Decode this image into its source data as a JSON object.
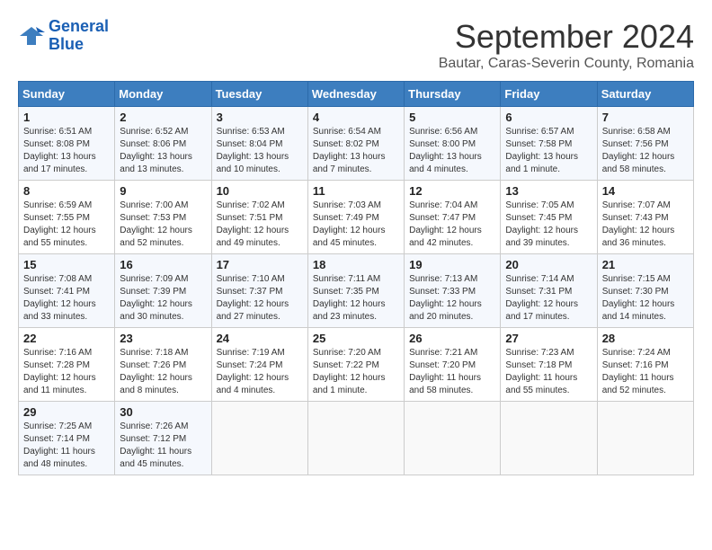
{
  "logo": {
    "line1": "General",
    "line2": "Blue"
  },
  "title": "September 2024",
  "subtitle": "Bautar, Caras-Severin County, Romania",
  "days_header": [
    "Sunday",
    "Monday",
    "Tuesday",
    "Wednesday",
    "Thursday",
    "Friday",
    "Saturday"
  ],
  "weeks": [
    [
      {
        "day": "1",
        "info": "Sunrise: 6:51 AM\nSunset: 8:08 PM\nDaylight: 13 hours\nand 17 minutes."
      },
      {
        "day": "2",
        "info": "Sunrise: 6:52 AM\nSunset: 8:06 PM\nDaylight: 13 hours\nand 13 minutes."
      },
      {
        "day": "3",
        "info": "Sunrise: 6:53 AM\nSunset: 8:04 PM\nDaylight: 13 hours\nand 10 minutes."
      },
      {
        "day": "4",
        "info": "Sunrise: 6:54 AM\nSunset: 8:02 PM\nDaylight: 13 hours\nand 7 minutes."
      },
      {
        "day": "5",
        "info": "Sunrise: 6:56 AM\nSunset: 8:00 PM\nDaylight: 13 hours\nand 4 minutes."
      },
      {
        "day": "6",
        "info": "Sunrise: 6:57 AM\nSunset: 7:58 PM\nDaylight: 13 hours\nand 1 minute."
      },
      {
        "day": "7",
        "info": "Sunrise: 6:58 AM\nSunset: 7:56 PM\nDaylight: 12 hours\nand 58 minutes."
      }
    ],
    [
      {
        "day": "8",
        "info": "Sunrise: 6:59 AM\nSunset: 7:55 PM\nDaylight: 12 hours\nand 55 minutes."
      },
      {
        "day": "9",
        "info": "Sunrise: 7:00 AM\nSunset: 7:53 PM\nDaylight: 12 hours\nand 52 minutes."
      },
      {
        "day": "10",
        "info": "Sunrise: 7:02 AM\nSunset: 7:51 PM\nDaylight: 12 hours\nand 49 minutes."
      },
      {
        "day": "11",
        "info": "Sunrise: 7:03 AM\nSunset: 7:49 PM\nDaylight: 12 hours\nand 45 minutes."
      },
      {
        "day": "12",
        "info": "Sunrise: 7:04 AM\nSunset: 7:47 PM\nDaylight: 12 hours\nand 42 minutes."
      },
      {
        "day": "13",
        "info": "Sunrise: 7:05 AM\nSunset: 7:45 PM\nDaylight: 12 hours\nand 39 minutes."
      },
      {
        "day": "14",
        "info": "Sunrise: 7:07 AM\nSunset: 7:43 PM\nDaylight: 12 hours\nand 36 minutes."
      }
    ],
    [
      {
        "day": "15",
        "info": "Sunrise: 7:08 AM\nSunset: 7:41 PM\nDaylight: 12 hours\nand 33 minutes."
      },
      {
        "day": "16",
        "info": "Sunrise: 7:09 AM\nSunset: 7:39 PM\nDaylight: 12 hours\nand 30 minutes."
      },
      {
        "day": "17",
        "info": "Sunrise: 7:10 AM\nSunset: 7:37 PM\nDaylight: 12 hours\nand 27 minutes."
      },
      {
        "day": "18",
        "info": "Sunrise: 7:11 AM\nSunset: 7:35 PM\nDaylight: 12 hours\nand 23 minutes."
      },
      {
        "day": "19",
        "info": "Sunrise: 7:13 AM\nSunset: 7:33 PM\nDaylight: 12 hours\nand 20 minutes."
      },
      {
        "day": "20",
        "info": "Sunrise: 7:14 AM\nSunset: 7:31 PM\nDaylight: 12 hours\nand 17 minutes."
      },
      {
        "day": "21",
        "info": "Sunrise: 7:15 AM\nSunset: 7:30 PM\nDaylight: 12 hours\nand 14 minutes."
      }
    ],
    [
      {
        "day": "22",
        "info": "Sunrise: 7:16 AM\nSunset: 7:28 PM\nDaylight: 12 hours\nand 11 minutes."
      },
      {
        "day": "23",
        "info": "Sunrise: 7:18 AM\nSunset: 7:26 PM\nDaylight: 12 hours\nand 8 minutes."
      },
      {
        "day": "24",
        "info": "Sunrise: 7:19 AM\nSunset: 7:24 PM\nDaylight: 12 hours\nand 4 minutes."
      },
      {
        "day": "25",
        "info": "Sunrise: 7:20 AM\nSunset: 7:22 PM\nDaylight: 12 hours\nand 1 minute."
      },
      {
        "day": "26",
        "info": "Sunrise: 7:21 AM\nSunset: 7:20 PM\nDaylight: 11 hours\nand 58 minutes."
      },
      {
        "day": "27",
        "info": "Sunrise: 7:23 AM\nSunset: 7:18 PM\nDaylight: 11 hours\nand 55 minutes."
      },
      {
        "day": "28",
        "info": "Sunrise: 7:24 AM\nSunset: 7:16 PM\nDaylight: 11 hours\nand 52 minutes."
      }
    ],
    [
      {
        "day": "29",
        "info": "Sunrise: 7:25 AM\nSunset: 7:14 PM\nDaylight: 11 hours\nand 48 minutes."
      },
      {
        "day": "30",
        "info": "Sunrise: 7:26 AM\nSunset: 7:12 PM\nDaylight: 11 hours\nand 45 minutes."
      },
      {
        "day": "",
        "info": ""
      },
      {
        "day": "",
        "info": ""
      },
      {
        "day": "",
        "info": ""
      },
      {
        "day": "",
        "info": ""
      },
      {
        "day": "",
        "info": ""
      }
    ]
  ]
}
